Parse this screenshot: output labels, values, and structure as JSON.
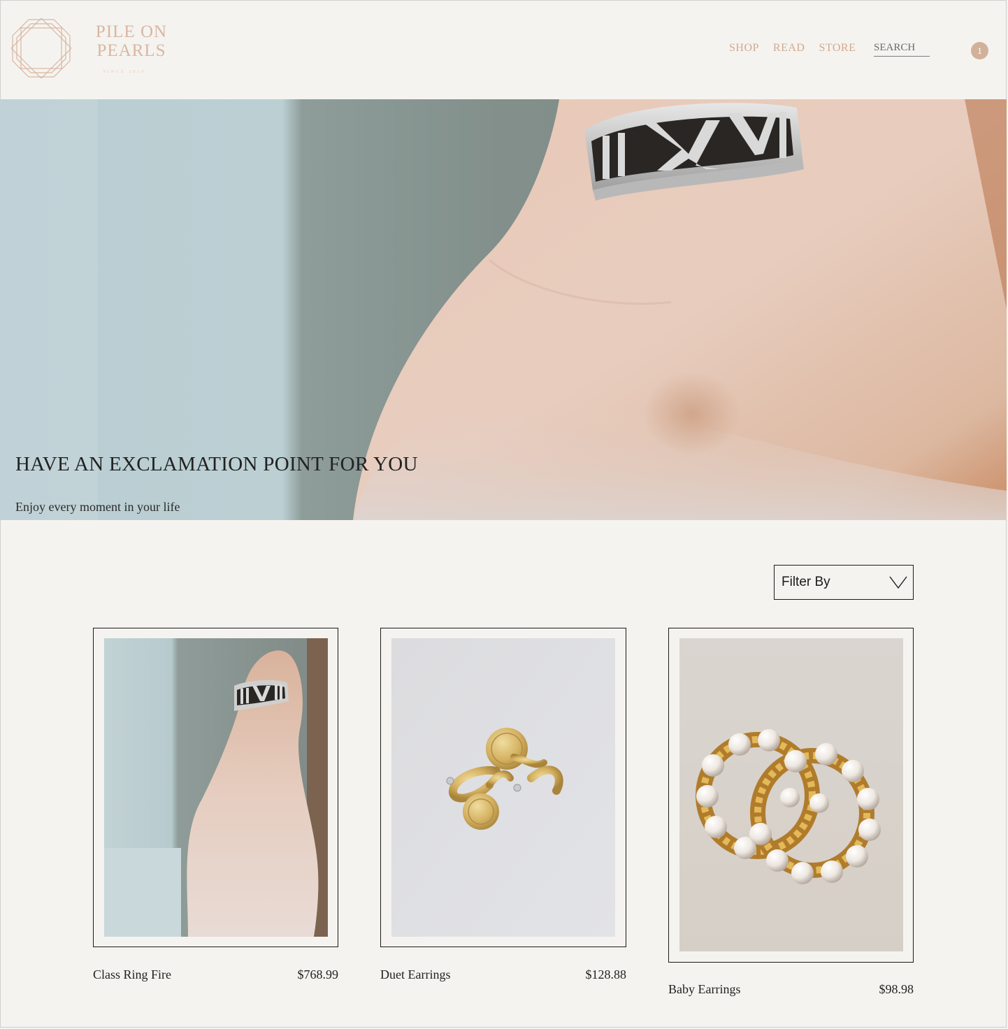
{
  "brand": {
    "line1": "PILE ON",
    "line2": "PEARLS",
    "tagline": "SINCE 2019"
  },
  "nav": {
    "items": [
      "SHOP",
      "READ",
      "STORE"
    ]
  },
  "search": {
    "placeholder": "SEARCH"
  },
  "cart": {
    "count": "1"
  },
  "hero": {
    "title": "HAVE AN EXCLAMATION POINT FOR YOU",
    "subtitle": "Enjoy every moment in your life"
  },
  "filter": {
    "label": "Filter By"
  },
  "products": [
    {
      "name": "Class Ring Fire",
      "price": "$768.99"
    },
    {
      "name": "Duet Earrings",
      "price": "$128.88"
    },
    {
      "name": "Baby Earrings",
      "price": "$98.98"
    }
  ],
  "colors": {
    "background": "#f5f3f0",
    "accent": "#d2a98e",
    "badge": "#d2b19a",
    "text": "#1f1f1f"
  }
}
